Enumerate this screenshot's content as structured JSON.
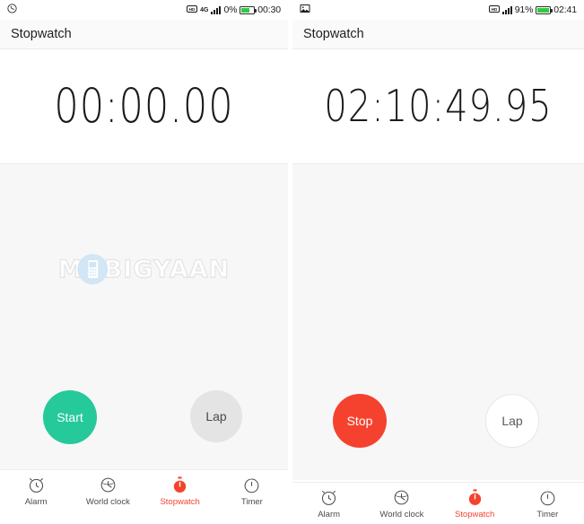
{
  "meta": {
    "app_name": "Stopwatch",
    "watermark_text_left": "M",
    "watermark_text_right": "BIGYAAN",
    "colors": {
      "accent_red": "#f5422f",
      "accent_green": "#25c99a",
      "battery_green": "#2ecc40",
      "body_bg": "#f7f7f7",
      "appbar_bg": "#fafafa",
      "lap_grey": "#e4e4e4"
    }
  },
  "screens": [
    {
      "id": "stopwatch-idle",
      "status_bar": {
        "left_icon": "whatsapp-icon",
        "network_icons": [
          "hd-call-icon",
          "4g-label",
          "signal-bars-icon"
        ],
        "network_label": "4G",
        "battery_percent": "0%",
        "battery_fill_ratio": 0.62,
        "clock": "00:30"
      },
      "app_bar": {
        "title": "Stopwatch"
      },
      "timer": {
        "value": "00:00.00"
      },
      "buttons": {
        "primary": {
          "label": "Start",
          "style": "green"
        },
        "secondary": {
          "label": "Lap",
          "style": "grey"
        }
      },
      "bottom_nav": {
        "active_index": 2,
        "items": [
          {
            "label": "Alarm",
            "icon": "alarm-clock-icon"
          },
          {
            "label": "World clock",
            "icon": "world-clock-icon"
          },
          {
            "label": "Stopwatch",
            "icon": "stopwatch-icon"
          },
          {
            "label": "Timer",
            "icon": "timer-icon"
          }
        ]
      }
    },
    {
      "id": "stopwatch-running",
      "status_bar": {
        "left_icon": "image-icon",
        "network_icons": [
          "hd-call-icon",
          "signal-bars-icon"
        ],
        "network_label": "HD",
        "battery_percent": "91%",
        "battery_fill_ratio": 0.91,
        "clock": "02:41"
      },
      "app_bar": {
        "title": "Stopwatch"
      },
      "timer": {
        "value": "02:10:49.95"
      },
      "buttons": {
        "primary": {
          "label": "Stop",
          "style": "red"
        },
        "secondary": {
          "label": "Lap",
          "style": "white"
        }
      },
      "bottom_nav": {
        "active_index": 2,
        "items": [
          {
            "label": "Alarm",
            "icon": "alarm-clock-icon"
          },
          {
            "label": "World clock",
            "icon": "world-clock-icon"
          },
          {
            "label": "Stopwatch",
            "icon": "stopwatch-icon"
          },
          {
            "label": "Timer",
            "icon": "timer-icon"
          }
        ]
      }
    }
  ]
}
